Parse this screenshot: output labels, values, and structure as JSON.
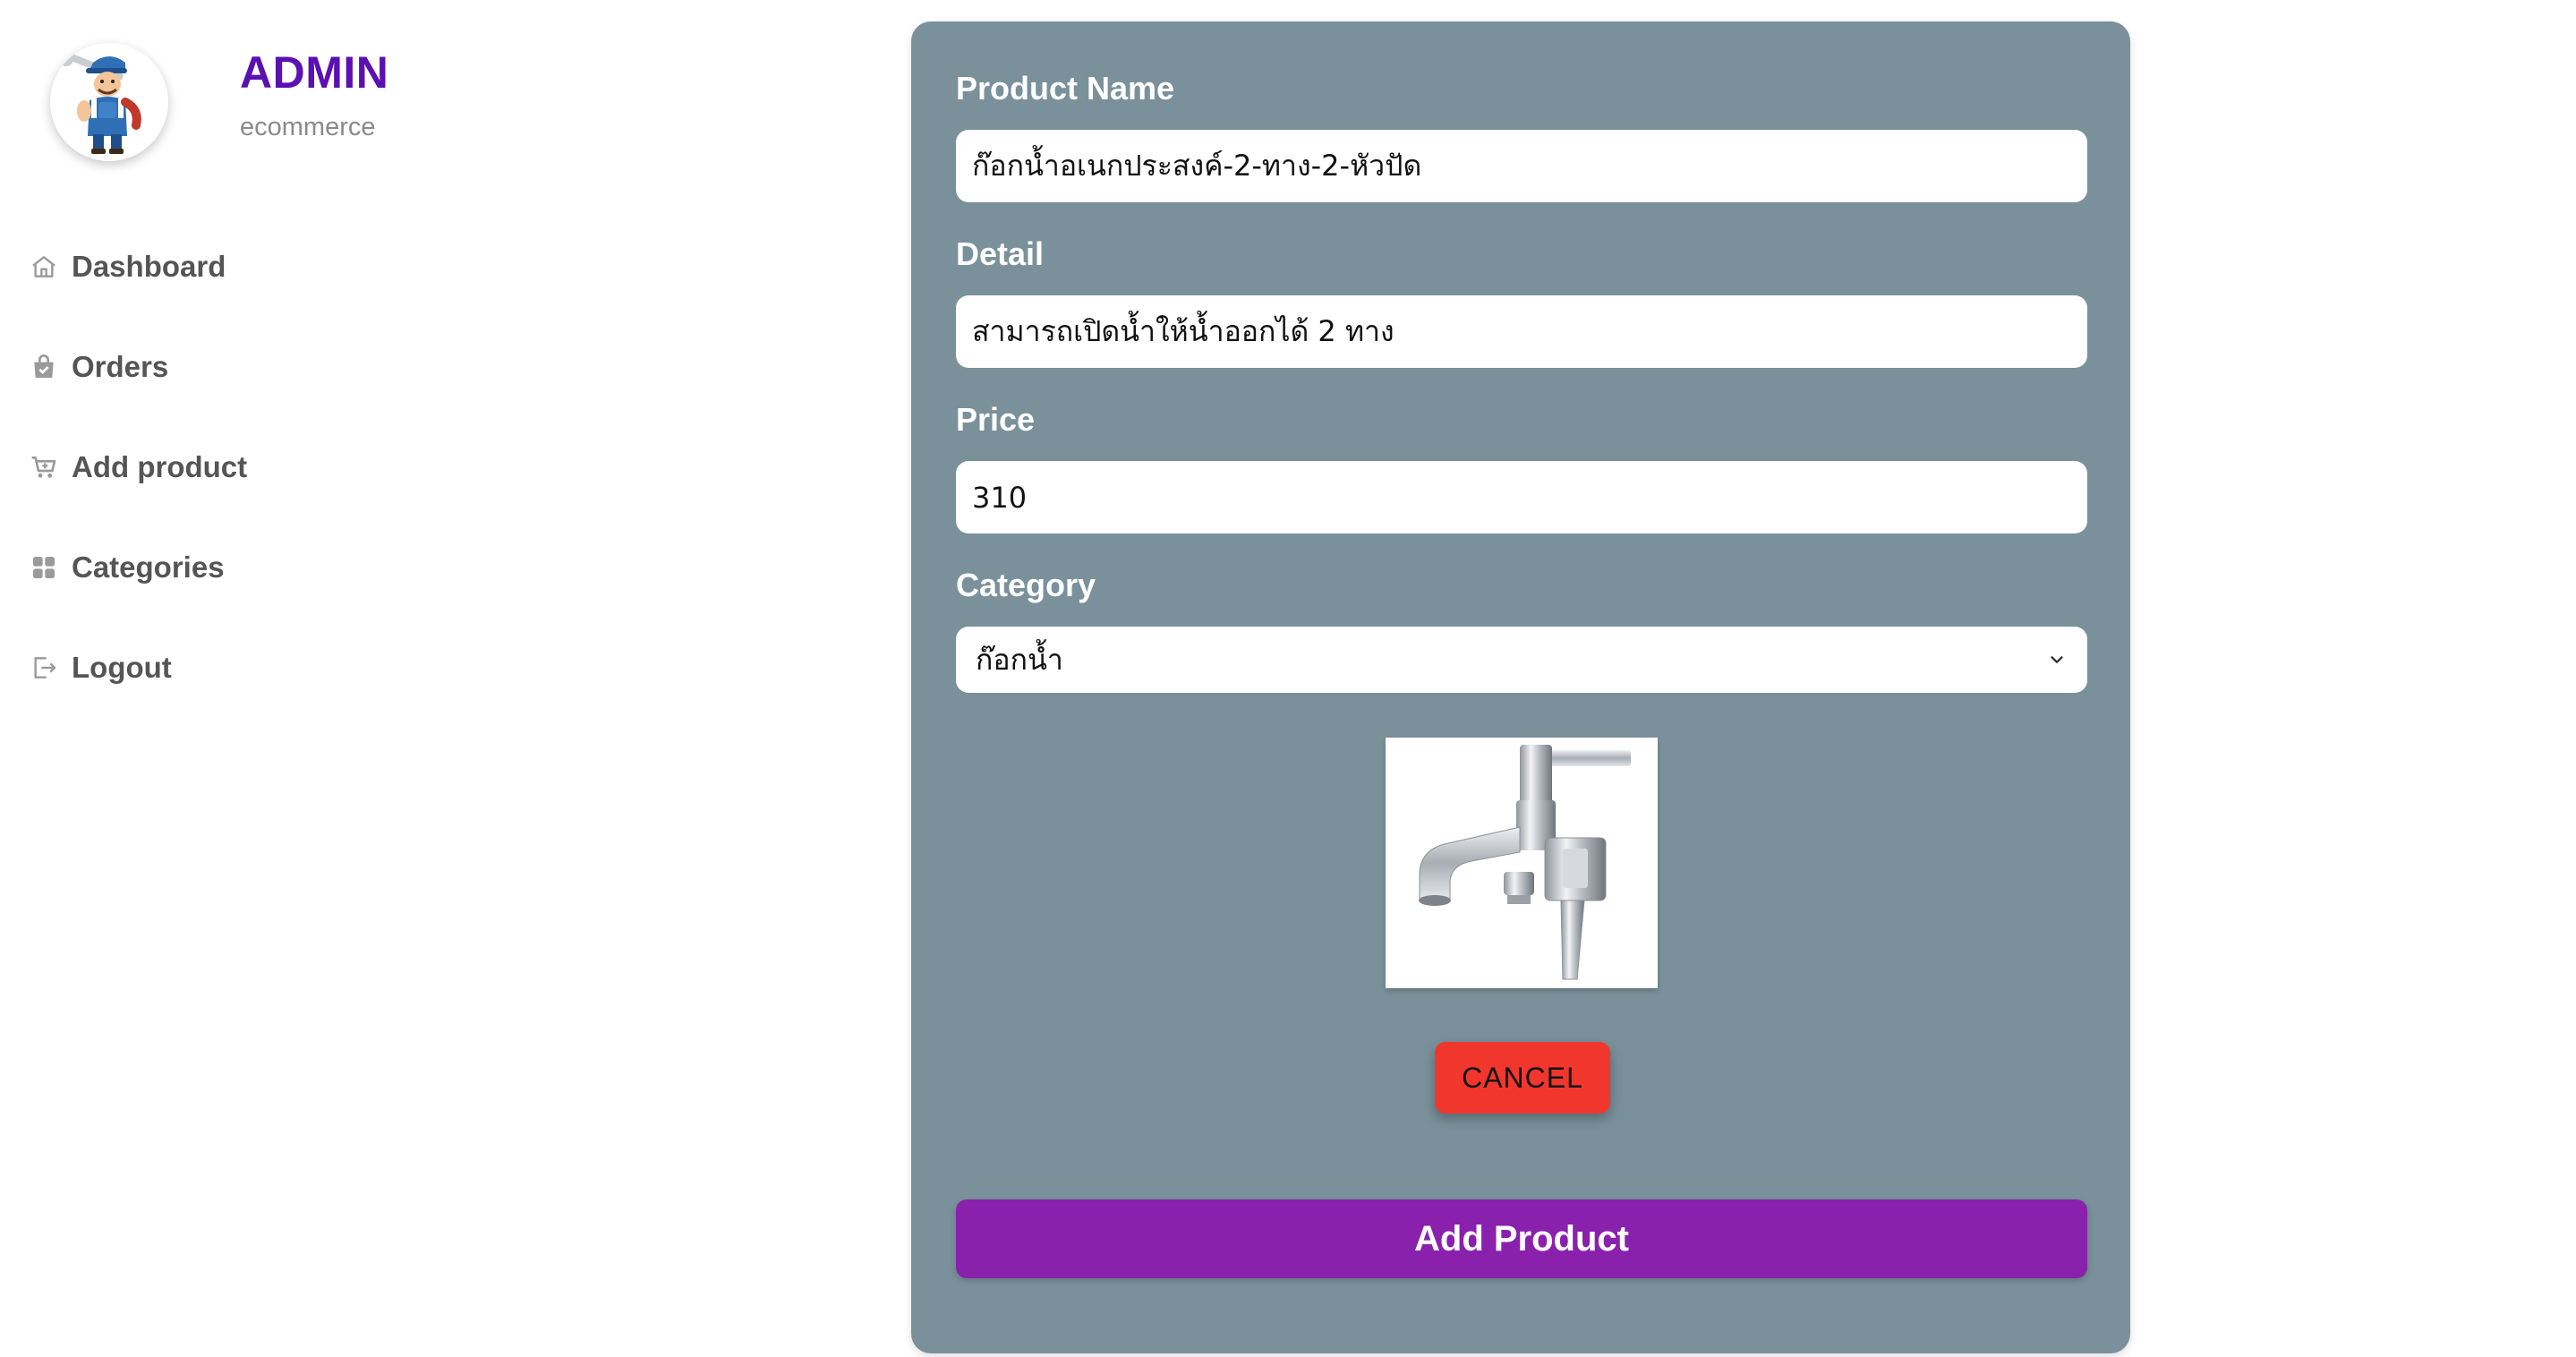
{
  "brand": {
    "title": "ADMIN",
    "subtitle": "ecommerce",
    "avatar_icon": "plumber-mascot-icon",
    "title_color": "#5b10b1"
  },
  "sidebar": {
    "items": [
      {
        "label": "Dashboard",
        "icon": "home-icon"
      },
      {
        "label": "Orders",
        "icon": "shopping-bag-icon"
      },
      {
        "label": "Add product",
        "icon": "cart-add-icon"
      },
      {
        "label": "Categories",
        "icon": "grid-icon"
      },
      {
        "label": "Logout",
        "icon": "logout-icon"
      }
    ]
  },
  "form": {
    "product_name": {
      "label": "Product Name",
      "value": "ก๊อกน้ำอเนกประสงค์-2-ทาง-2-หัวปัด"
    },
    "detail": {
      "label": "Detail",
      "value": "สามารถเปิดน้ำให้น้ำออกได้ 2 ทาง"
    },
    "price": {
      "label": "Price",
      "value": "310"
    },
    "category": {
      "label": "Category",
      "selected": "ก๊อกน้ำ"
    },
    "image_icon": "faucet-product-image",
    "cancel_label": "CANCEL",
    "submit_label": "Add Product"
  },
  "colors": {
    "panel_bg": "#7a919b",
    "cancel_bg": "#f1372d",
    "submit_bg": "#8a21ad"
  }
}
